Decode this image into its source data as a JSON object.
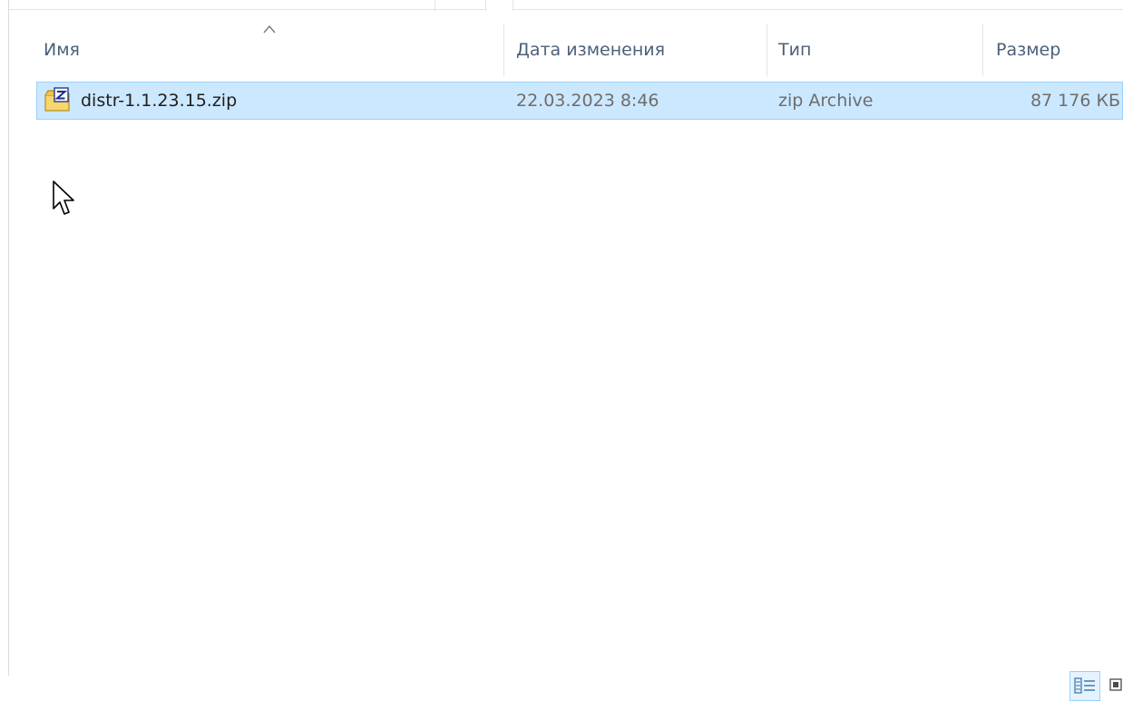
{
  "columns": {
    "name": "Имя",
    "date": "Дата изменения",
    "type": "Тип",
    "size": "Размер"
  },
  "sort": {
    "column": "name",
    "direction": "ascending",
    "icon": "chevron-up-icon"
  },
  "files": [
    {
      "name": "distr-1.1.23.15.zip",
      "date": "22.03.2023 8:46",
      "type": "zip Archive",
      "size": "87 176 КБ",
      "icon": "zip-archive-icon",
      "selected": true
    }
  ],
  "view": {
    "active": "details",
    "buttons": [
      "details-view-icon",
      "large-icons-view-icon"
    ]
  },
  "colors": {
    "selection_bg": "#cce8ff",
    "selection_border": "#99d1ff",
    "header_text": "#4c607a"
  }
}
